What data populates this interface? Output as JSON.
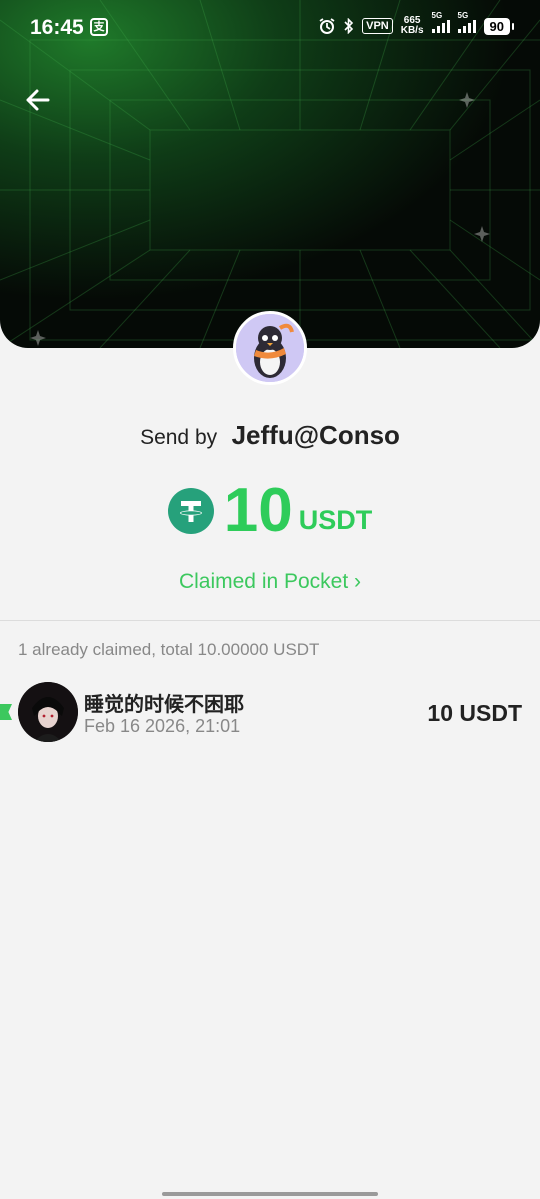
{
  "status_bar": {
    "time": "16:45",
    "app_icon_glyph": "支",
    "vpn": "VPN",
    "speed_value": "665",
    "speed_unit": "KB/s",
    "network_1": "5G",
    "network_2": "5G",
    "battery": "90"
  },
  "header": {
    "back_icon": "arrow-left-icon",
    "accent_color": "#1f7a2a"
  },
  "sender": {
    "prefix": "Send by",
    "name": "Jeffu@Conso"
  },
  "amount": {
    "value": "10",
    "unit": "USDT",
    "color": "#2ecc5a"
  },
  "claimed_link": "Claimed in Pocket ›",
  "summary": "1 already claimed, total 10.00000 USDT",
  "claims": [
    {
      "name": "睡觉的时候不困耶",
      "time": "Feb 16 2026, 21:01",
      "amount": "10 USDT"
    }
  ]
}
